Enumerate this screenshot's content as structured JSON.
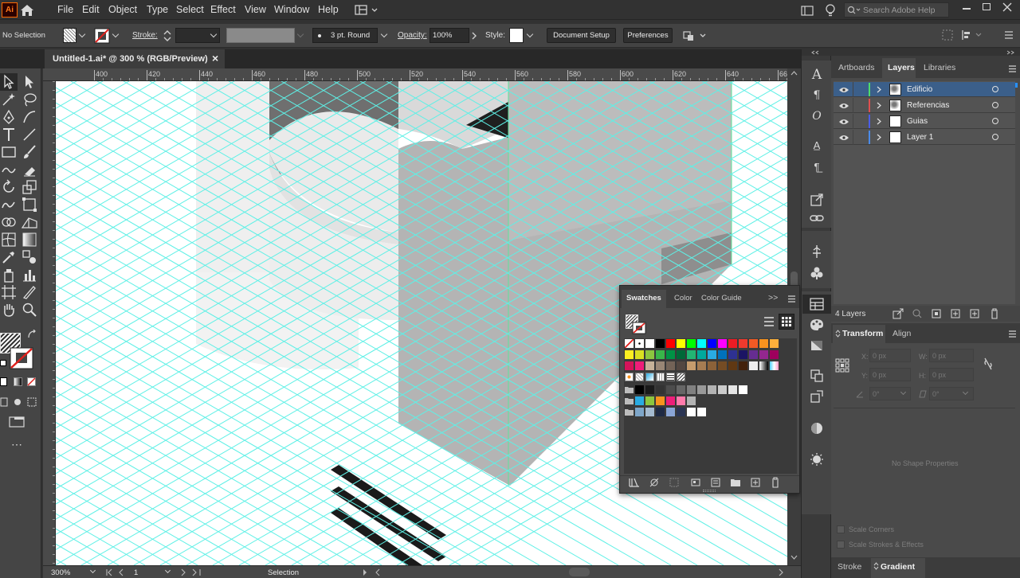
{
  "app": {
    "logo": "Ai",
    "home_icon": "home-icon"
  },
  "menu": [
    "File",
    "Edit",
    "Object",
    "Type",
    "Select",
    "Effect",
    "View",
    "Window",
    "Help"
  ],
  "search": {
    "placeholder": "Search Adobe Help"
  },
  "control": {
    "selection_label": "No Selection",
    "stroke_label": "Stroke:",
    "brush_label": "3 pt. Round",
    "opacity_label": "Opacity:",
    "opacity_value": "100%",
    "style_label": "Style:",
    "document_setup": "Document Setup",
    "preferences": "Preferences"
  },
  "document": {
    "tab_title": "Untitled-1.ai* @ 300 % (RGB/Preview)",
    "close": "×"
  },
  "ruler": {
    "h_labels": [
      "400",
      "420",
      "440",
      "460",
      "480",
      "500",
      "520",
      "540",
      "560",
      "580",
      "600",
      "620",
      "640",
      "66"
    ]
  },
  "status": {
    "zoom": "300%",
    "artboard": "1",
    "tool": "Selection"
  },
  "layers_panel": {
    "tabs": [
      "Artboards",
      "Layers",
      "Libraries"
    ],
    "active_tab": "Layers",
    "layers": [
      {
        "name": "Edificio",
        "color": "#4fdc6b",
        "selected": true
      },
      {
        "name": "Referencias",
        "color": "#e04f4f",
        "selected": false
      },
      {
        "name": "Guias",
        "color": "#4b5ee8",
        "selected": false
      },
      {
        "name": "Layer 1",
        "color": "#4b8be8",
        "selected": false
      }
    ],
    "count": "4 Layers"
  },
  "transform_panel": {
    "tabs": [
      "Transform",
      "Align"
    ],
    "x_label": "X:",
    "x_value": "0 px",
    "y_label": "Y:",
    "y_value": "0 px",
    "w_label": "W:",
    "w_value": "0 px",
    "h_label": "H:",
    "h_value": "0 px",
    "angle_value": "0°",
    "shear_value": "0°",
    "empty_message": "No Shape Properties",
    "scale_corners": "Scale Corners",
    "scale_strokes": "Scale Strokes & Effects"
  },
  "bottom_tabs": [
    "Stroke",
    "Gradient"
  ],
  "swatches_panel": {
    "tabs": [
      "Swatches",
      "Color",
      "Color Guide"
    ],
    "expand": ">>"
  },
  "colors": {
    "grid": "#5ef0e6",
    "accent": "#0e8ee9",
    "canvas": "#ffffff",
    "building": "#b7b7b7"
  }
}
